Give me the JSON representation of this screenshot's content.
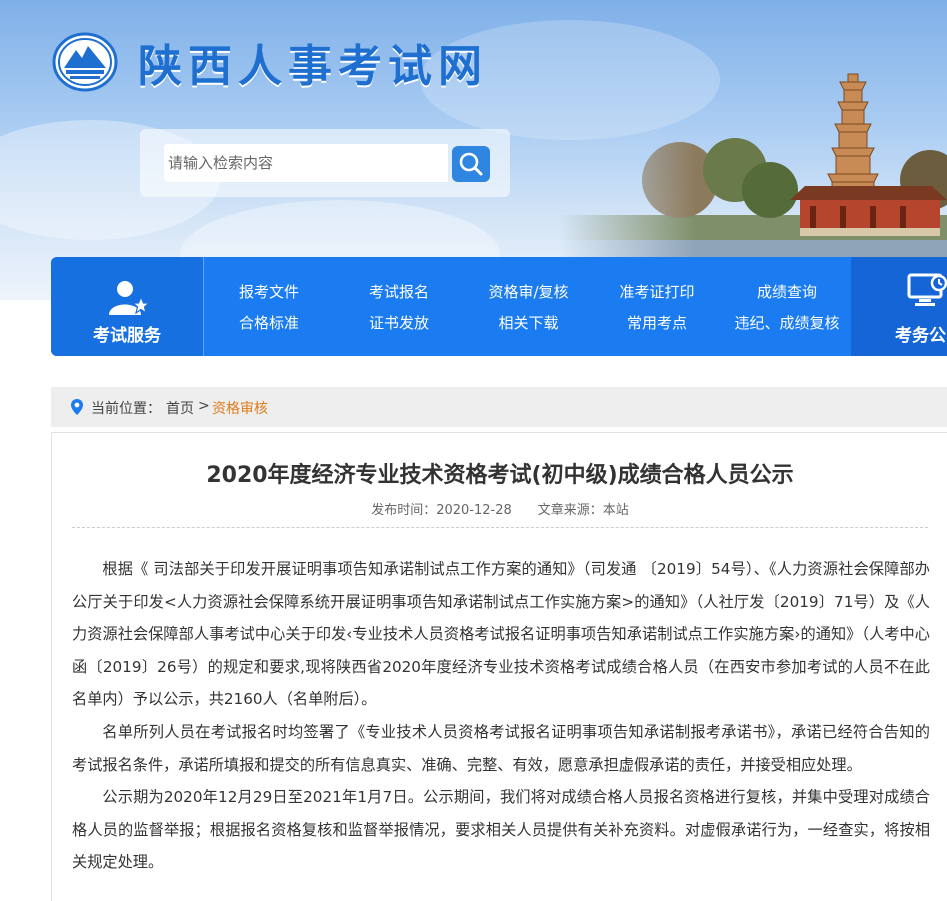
{
  "header": {
    "site_title": "陕西人事考试网",
    "search_placeholder": "请输入检索内容"
  },
  "nav": {
    "service_label": "考试服务",
    "columns": [
      {
        "top": "报考文件",
        "bottom": "合格标准"
      },
      {
        "top": "考试报名",
        "bottom": "证书发放"
      },
      {
        "top": "资格审/复核",
        "bottom": "相关下载"
      },
      {
        "top": "准考证打印",
        "bottom": "常用考点"
      },
      {
        "top": "成绩查询",
        "bottom": "违纪、成绩复核"
      }
    ],
    "right_label": "考务公"
  },
  "breadcrumb": {
    "prefix": "当前位置：",
    "home": "首页",
    "sep": ">",
    "current": "资格审核"
  },
  "article": {
    "title": "2020年度经济专业技术资格考试(初中级)成绩合格人员公示",
    "meta": "发布时间：2020-12-28　　文章来源：本站",
    "paragraphs": [
      "根据《 司法部关于印发开展证明事项告知承诺制试点工作方案的通知》（司发通 〔2019〕54号）、《人力资源社会保障部办公厅关于印发<人力资源社会保障系统开展证明事项告知承诺制试点工作实施方案>的通知》（人社厅发〔2019〕71号）及《人力资源社会保障部人事考试中心关于印发‹专业技术人员资格考试报名证明事项告知承诺制试点工作实施方案›的通知》（人考中心函〔2019〕26号）的规定和要求,现将陕西省2020年度经济专业技术资格考试成绩合格人员（在西安市参加考试的人员不在此名单内）予以公示，共2160人（名单附后）。",
      "名单所列人员在考试报名时均签署了《专业技术人员资格考试报名证明事项告知承诺制报考承诺书》，承诺已经符合告知的考试报名条件，承诺所填报和提交的所有信息真实、准确、完整、有效，愿意承担虚假承诺的责任，并接受相应处理。",
      "公示期为2020年12月29日至2021年1月7日。公示期间，我们将对成绩合格人员报名资格进行复核，并集中受理对成绩合格人员的监督举报；根据报名资格复核和监督举报情况，要求相关人员提供有关补充资料。对虚假承诺行为，一经查实，将按相关规定处理。"
    ]
  },
  "colors": {
    "brand_blue": "#1a7cf0",
    "title_blue": "#1f6fd0",
    "breadcrumb_current": "#e07b1a"
  },
  "icons": [
    "site-logo-icon",
    "search-icon",
    "exam-service-icon",
    "location-pin-icon",
    "monitor-clock-icon"
  ]
}
